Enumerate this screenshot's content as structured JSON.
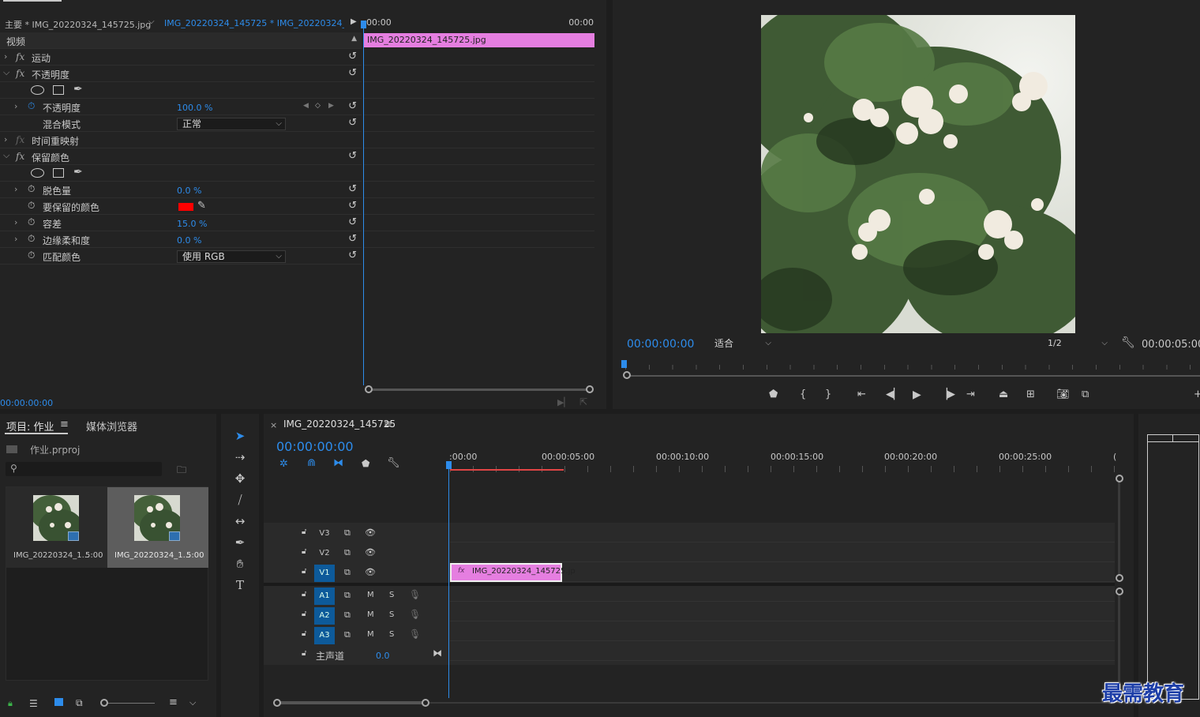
{
  "effect_controls": {
    "source_label": "主要 * IMG_20220324_145725.jpg",
    "sequence_label": "IMG_20220324_145725 * IMG_20220324_...",
    "section_video": "视频",
    "effects": [
      {
        "name": "运动"
      },
      {
        "name": "不透明度"
      },
      {
        "name": "时间重映射"
      },
      {
        "name": "保留颜色"
      }
    ],
    "opacity_param": "不透明度",
    "opacity_value": "100.0 %",
    "blend_mode_label": "混合模式",
    "blend_mode_value": "正常",
    "desaturate_label": "脱色量",
    "desaturate_value": "0.0 %",
    "color_to_keep_label": "要保留的颜色",
    "color_to_keep_swatch": "#ff0000",
    "tolerance_label": "容差",
    "tolerance_value": "15.0 %",
    "edge_softness_label": "边缘柔和度",
    "edge_softness_value": "0.0 %",
    "match_colors_label": "匹配颜色",
    "match_colors_value": "使用 RGB",
    "mini_timeline_start": "00:00",
    "mini_timeline_end": "00:00",
    "clip_name": "IMG_20220324_145725.jpg",
    "current_time": "00:00:00:00"
  },
  "program_monitor": {
    "timecode": "00:00:00:00",
    "zoom_value": "适合",
    "resolution_value": "1/2",
    "duration": "00:00:05:00"
  },
  "project": {
    "tab_project": "项目: 作业",
    "tab_media_browser": "媒体浏览器",
    "project_file": "作业.prproj",
    "items": [
      {
        "name": "IMG_20220324_1...",
        "duration": "5:00"
      },
      {
        "name": "IMG_20220324_1...",
        "duration": "5:00"
      }
    ]
  },
  "timeline": {
    "tab": "IMG_20220324_145725",
    "timecode": "00:00:00:00",
    "ruler": [
      ":00:00",
      "00:00:05:00",
      "00:00:10:00",
      "00:00:15:00",
      "00:00:20:00",
      "00:00:25:00",
      "("
    ],
    "video_tracks": [
      "V3",
      "V2",
      "V1"
    ],
    "audio_tracks": [
      "A1",
      "A2",
      "A3"
    ],
    "mute": "M",
    "solo": "S",
    "master_label": "主声道",
    "master_value": "0.0",
    "clip_name": "IMG_20220324_145725.jp"
  },
  "watermark": "最需教育",
  "colors": {
    "accent": "#2d8ceb",
    "clip_pink": "#e57ee0",
    "track_target": "#0d5a9a",
    "swatch": "#ff0000"
  }
}
